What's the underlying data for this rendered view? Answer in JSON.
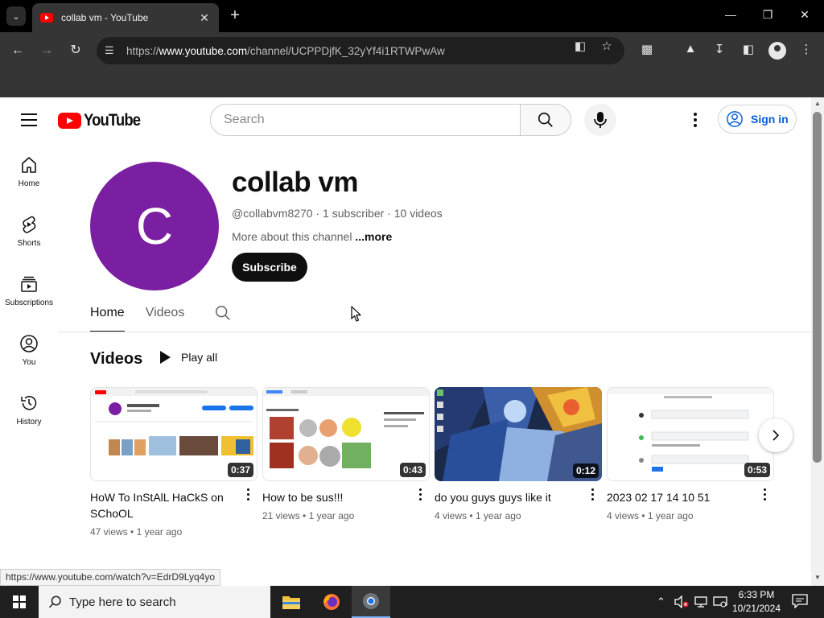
{
  "browser": {
    "tab_title": "collab vm - YouTube",
    "url_prefix": "https://",
    "url_host": "www.youtube.com",
    "url_path": "/channel/UCPPDjfK_32yYf4i1RTWPwAw",
    "status_url": "https://www.youtube.com/watch?v=EdrD9Lyq4yo"
  },
  "header": {
    "logo_text": "YouTube",
    "search_placeholder": "Search",
    "signin_label": "Sign in"
  },
  "guide": [
    {
      "label": "Home",
      "icon": "home-icon"
    },
    {
      "label": "Shorts",
      "icon": "shorts-icon"
    },
    {
      "label": "Subscriptions",
      "icon": "subscriptions-icon"
    },
    {
      "label": "You",
      "icon": "you-icon"
    },
    {
      "label": "History",
      "icon": "history-icon"
    }
  ],
  "channel": {
    "avatar_letter": "C",
    "avatar_color": "#7b1fa2",
    "name": "collab vm",
    "handle_meta": "@collabvm8270 · 1 subscriber · 10 videos",
    "about": "More about this channel ",
    "more_link": "...more",
    "subscribe_label": "Subscribe",
    "tabs": [
      "Home",
      "Videos"
    ]
  },
  "shelf": {
    "title": "Videos",
    "play_all": "Play all",
    "videos": [
      {
        "title": "HoW To InStAlL HaCkS on SChoOL",
        "duration": "0:37",
        "views": "47 views",
        "age": "1 year ago"
      },
      {
        "title": "How to be sus!!!",
        "duration": "0:43",
        "views": "21 views",
        "age": "1 year ago"
      },
      {
        "title": "do you guys guys like it",
        "duration": "0:12",
        "views": "4 views",
        "age": "1 year ago"
      },
      {
        "title": "2023 02 17 14 10 51",
        "duration": "0:53",
        "views": "4 views",
        "age": "1 year ago"
      }
    ]
  },
  "taskbar": {
    "search_placeholder": "Type here to search",
    "time": "6:33 PM",
    "date": "10/21/2024"
  }
}
